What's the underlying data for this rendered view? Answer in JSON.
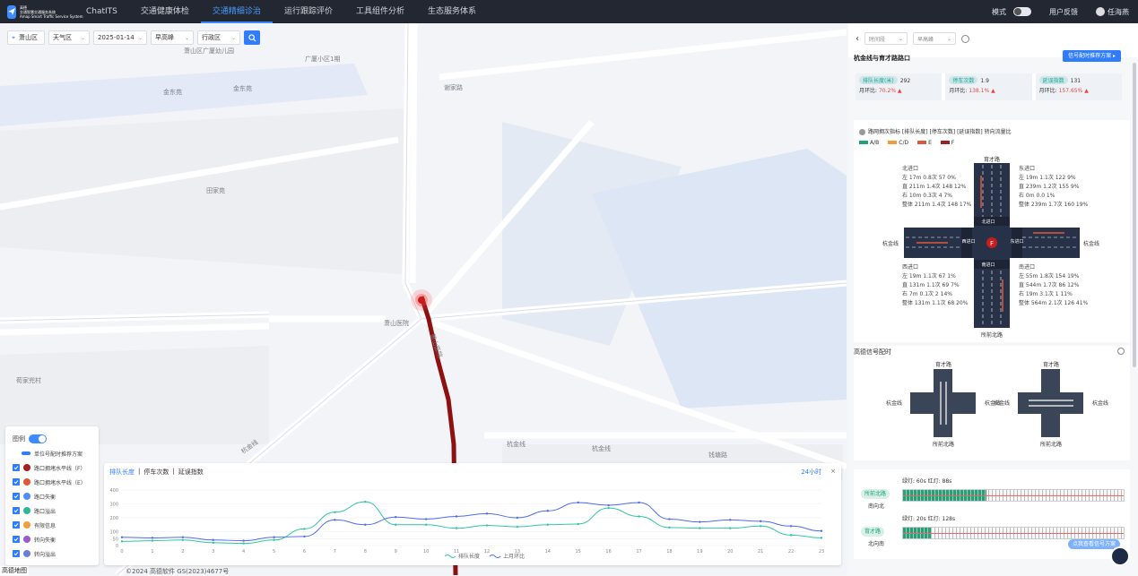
{
  "app": {
    "logo_line1": "高德",
    "logo_line2": "交通智慧交通服务系统",
    "logo_line3": "Amap Smart Traffic Service System"
  },
  "nav": [
    {
      "label": "ChatITS"
    },
    {
      "label": "交通健康体检"
    },
    {
      "label": "交通精细诊治",
      "active": true
    },
    {
      "label": "运行跟踪评价"
    },
    {
      "label": "工具组件分析"
    },
    {
      "label": "生态服务体系"
    }
  ],
  "topright": {
    "mode_label": "模式",
    "mode_toggle_text": "浅",
    "feedback": "用户反馈",
    "user": "任海燕"
  },
  "filters": {
    "region": "萧山区",
    "weather": "天气区",
    "date": "2025-01-14",
    "peak": "早高峰",
    "district": "行政区"
  },
  "map_labels": {
    "l1": "萧山区广厦幼儿园",
    "l2": "广厦小区1期",
    "l3": "金东苑",
    "l4": "金东苑",
    "l5": "谢家路",
    "l6": "田家苑",
    "l7": "萧山医院",
    "l8": "荀家兜村",
    "l9": "杭金线",
    "l10": "萧山医院",
    "l11": "杭金线",
    "l12": "钱塘路"
  },
  "legend": {
    "title": "图例",
    "rows": [
      {
        "label": "单位号配时推荐方案",
        "icon": "link-icon"
      },
      {
        "label": "路口拥堵水平线（F）",
        "icon": "marker-f-icon"
      },
      {
        "label": "路口拥堵水平线（E）",
        "icon": "marker-e-icon"
      },
      {
        "label": "路口失衡",
        "icon": "marker-imbalance-icon"
      },
      {
        "label": "路口溢出",
        "icon": "marker-overflow-icon"
      },
      {
        "label": "有限信息",
        "icon": "marker-info-icon"
      },
      {
        "label": "转向失衡",
        "icon": "marker-turn-icon"
      },
      {
        "label": "转向溢出",
        "icon": "marker-turnover-icon"
      }
    ]
  },
  "chart_panel": {
    "tab1": "排队长度",
    "tab2": "停车次数",
    "tab3": "延误指数",
    "range": "24小时",
    "close": "×",
    "legend_a": "排队长度",
    "legend_b": "上月环比"
  },
  "chart_data": {
    "type": "line",
    "x": [
      0,
      1,
      2,
      3,
      4,
      5,
      6,
      7,
      8,
      9,
      10,
      11,
      12,
      13,
      14,
      15,
      16,
      17,
      18,
      19,
      20,
      21,
      22,
      23
    ],
    "ylim": [
      0,
      400
    ],
    "yticks": [
      0,
      50,
      100,
      200,
      300,
      400
    ],
    "series": [
      {
        "name": "排队长度",
        "color": "#2fc7a2",
        "values": [
          30,
          35,
          40,
          20,
          15,
          40,
          120,
          240,
          315,
          150,
          150,
          125,
          145,
          135,
          150,
          155,
          270,
          210,
          130,
          125,
          125,
          140,
          75,
          55
        ]
      },
      {
        "name": "上月环比",
        "color": "#4f6cf0",
        "values": [
          60,
          55,
          60,
          40,
          35,
          60,
          65,
          185,
          150,
          205,
          190,
          210,
          230,
          200,
          250,
          310,
          290,
          310,
          190,
          170,
          185,
          175,
          140,
          105
        ]
      }
    ]
  },
  "copyright": "©2024 高德软件 GS(2023)4677号",
  "mapcorner": "高德地图",
  "side": {
    "sel1": "时间段",
    "sel2": "早高峰",
    "node_title": "杭金线与育才路路口",
    "plan_btn": "信号配时推荐方案 ▸",
    "metrics": [
      {
        "tag": "排队长度(米)",
        "value": "292",
        "mom_label": "月环比:",
        "mom": "70.2% ▲"
      },
      {
        "tag": "停车次数",
        "value": "1.9",
        "mom_label": "月环比:",
        "mom": "138.1% ▲"
      },
      {
        "tag": "延误指数",
        "value": "131",
        "mom_label": "月环比:",
        "mom": "157.65% ▲"
      }
    ],
    "diag_title": "路网拥次指标 [排队长度] [停车次数] [延误指数] 转向流量比",
    "los": [
      {
        "label": "A/B",
        "color": "#1aa57a"
      },
      {
        "label": "C/D",
        "color": "#f39c3a"
      },
      {
        "label": "E",
        "color": "#e0573a"
      },
      {
        "label": "F",
        "color": "#a51d1d"
      }
    ],
    "north": "育才路",
    "south": "所前北路",
    "west": "杭金线",
    "east": "杭金线",
    "nw": {
      "title": "北进口",
      "l1": "左  17m 0.8次 57 0%",
      "l2": "直  211m 1.4次 148 12%",
      "l3": "右  10m 0.3次 4 7%",
      "l4": "整体  211m 1.4次 148 17%"
    },
    "ne": {
      "title": "东进口",
      "l1": "左  19m 1.1次 122 9%",
      "l2": "直  239m 1.2次 155 9%",
      "l3": "右  0m 0.0 1%",
      "l4": "整体  239m 1.7次 160 19%"
    },
    "sw": {
      "title": "西进口",
      "l1": "左  19m 1.1次 67 1%",
      "l2": "直  131m 1.1次 69 7%",
      "l3": "右  7m 0.1次 2 14%",
      "l4": "整体  131m 1.1次 68 20%"
    },
    "se": {
      "title": "南进口",
      "l1": "左  55m 1.8次 154 19%",
      "l2": "直  544m 1.7次 86 12%",
      "l3": "右  19m 3.1次 1 11%",
      "l4": "整体  564m 2.1次 126 41%"
    },
    "center_n": "北进口",
    "center_s": "南进口",
    "center_w": "西进口",
    "center_e": "东进口",
    "center_grade": "F",
    "signal_title": "高德信号配时",
    "phase1": {
      "tag": "所前北路",
      "dir": "南向北",
      "timing": "绿灯: 60s 红灯: 88s",
      "green_fraction": 0.38
    },
    "phase2": {
      "tag": "育才路",
      "dir": "北向南",
      "timing": "绿灯: 20s 红灯: 128s",
      "green_fraction": 0.13
    },
    "float_btn": "点我查看信号方案"
  }
}
